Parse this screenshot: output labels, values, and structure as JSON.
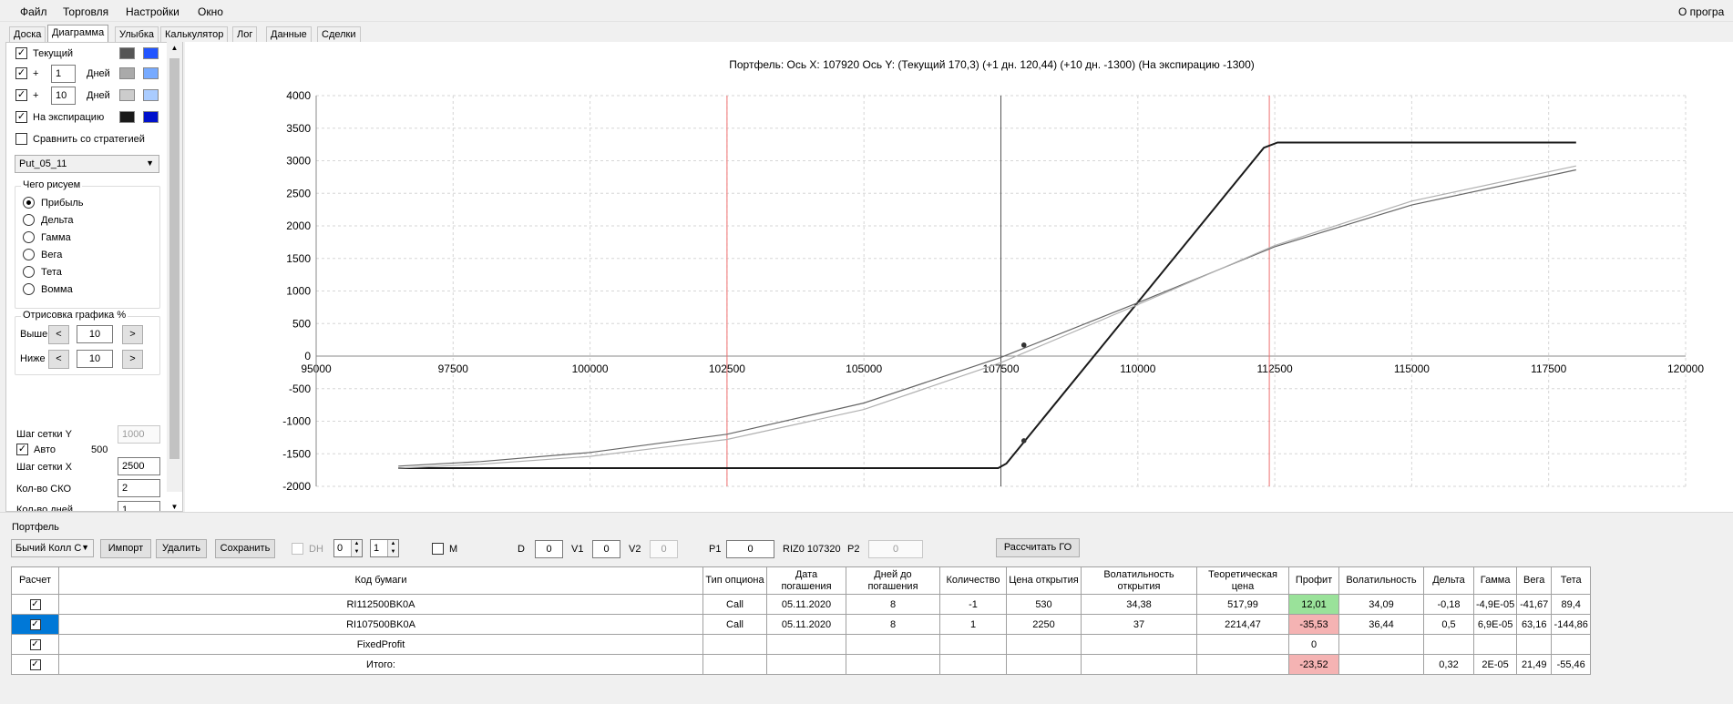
{
  "menu": {
    "file": "Файл",
    "trade": "Торговля",
    "settings": "Настройки",
    "window": "Окно",
    "about": "О програ"
  },
  "tabs": [
    "Доска",
    "Диаграмма",
    "Улыбка",
    "Калькулятор",
    "Лог",
    "Данные",
    "Сделки"
  ],
  "active_tab": "Диаграмма",
  "left": {
    "current_label": "Текущий",
    "plus": "+",
    "days_label": "Дней",
    "days1": "1",
    "days2": "10",
    "expiry_label": "На экспирацию",
    "compare_label": "Сравнить со стратегией",
    "strategy_select": "Put_05_11",
    "what_group": "Чего рисуем",
    "radios": [
      "Прибыль",
      "Дельта",
      "Гамма",
      "Вега",
      "Тета",
      "Вомма"
    ],
    "draw_group": "Отрисовка графика %",
    "above_label": "Выше",
    "below_label": "Ниже",
    "above_value": "10",
    "below_value": "10",
    "prev_glyph": "<",
    "next_glyph": ">",
    "grid_y_label": "Шаг сетки Y",
    "grid_y_value": "1000",
    "auto_label": "Авто",
    "auto_value": "500",
    "grid_x_label": "Шаг сетки X",
    "grid_x_value": "2500",
    "sko_label": "Кол-во СКО",
    "sko_value": "2",
    "days_count_label": "Кол-во дней",
    "days_count_value": "1"
  },
  "colors": {
    "current": [
      "#555555",
      "#2255ff"
    ],
    "plus1": [
      "#aaaaaa",
      "#77aaff"
    ],
    "plus10": [
      "#cccccc",
      "#aaccff"
    ],
    "expiry": [
      "#1a1a1a",
      "#0011cc"
    ]
  },
  "chart_data": {
    "type": "line",
    "title": "Портфель: Ось X: 107920 Ось Y:  (Текущий 170,3)  (+1 дн. 120,44)  (+10 дн. -1300)  (На экспирацию -1300)",
    "xlim": [
      95000,
      120000
    ],
    "ylim": [
      -2000,
      4000
    ],
    "x_ticks": [
      "95000",
      "97500",
      "100000",
      "102500",
      "105000",
      "107500",
      "110000",
      "112500",
      "115000",
      "117500",
      "120000"
    ],
    "y_ticks": [
      "4000",
      "3500",
      "3000",
      "2500",
      "2000",
      "1500",
      "1000",
      "500",
      "0",
      "-500",
      "-1000",
      "-1500",
      "-2000"
    ],
    "cursor_x": 107500,
    "red_lines": [
      102500,
      112400
    ],
    "markers": [
      {
        "x": 107920,
        "y": 170
      },
      {
        "x": 107920,
        "y": -1300
      }
    ],
    "series": [
      {
        "color": "#1a1a1a",
        "x": [
          96500,
          107450,
          107600,
          112300,
          112550,
          118000
        ],
        "y": [
          -1720,
          -1720,
          -1650,
          3200,
          3280,
          3280
        ]
      },
      {
        "color": "#666666",
        "x": [
          96500,
          98000,
          100000,
          102500,
          105000,
          107500,
          110000,
          112500,
          115000,
          118000
        ],
        "y": [
          -1690,
          -1620,
          -1480,
          -1200,
          -720,
          -20,
          820,
          1680,
          2320,
          2860
        ]
      },
      {
        "color": "#b0b0b0",
        "x": [
          96500,
          98000,
          100000,
          102500,
          105000,
          107500,
          110000,
          112500,
          115000,
          118000
        ],
        "y": [
          -1720,
          -1660,
          -1540,
          -1280,
          -820,
          -100,
          790,
          1700,
          2380,
          2920
        ]
      }
    ]
  },
  "portfolio": {
    "title": "Портфель",
    "select": "Бычий Колл С",
    "import": "Импорт",
    "delete": "Удалить",
    "save": "Сохранить",
    "dh": "DH",
    "spin1": "0",
    "spin2": "1",
    "m": "M",
    "d_label": "D",
    "d_value": "0",
    "v1_label": "V1",
    "v1_value": "0",
    "v2_label": "V2",
    "v2_value": "0",
    "p1_label": "P1",
    "p1_value": "0",
    "riz": "RIZ0 107320",
    "p2_label": "P2",
    "p2_value": "0",
    "calc_go": "Рассчитать ГО"
  },
  "table": {
    "headers": [
      "Расчет",
      "Код бумаги",
      "Тип опциона",
      "Дата погашения",
      "Дней до погашения",
      "Количество",
      "Цена открытия",
      "Волатильность открытия",
      "Теоретическая цена",
      "Профит",
      "Волатильность",
      "Дельта",
      "Гамма",
      "Вега",
      "Тета"
    ],
    "rows": [
      [
        "",
        "RI112500BK0A",
        "Call",
        "05.11.2020",
        "8",
        "-1",
        "530",
        "34,38",
        "517,99",
        "12,01",
        "34,09",
        "-0,18",
        "-4,9E-05",
        "-41,67",
        "89,4"
      ],
      [
        "",
        "RI107500BK0A",
        "Call",
        "05.11.2020",
        "8",
        "1",
        "2250",
        "37",
        "2214,47",
        "-35,53",
        "36,44",
        "0,5",
        "6,9E-05",
        "63,16",
        "-144,86"
      ],
      [
        "",
        "FixedProfit",
        "",
        "",
        "",
        "",
        "",
        "",
        "",
        "0",
        "",
        "",
        "",
        "",
        ""
      ],
      [
        "",
        "Итого:",
        "",
        "",
        "",
        "",
        "",
        "",
        "",
        "-23,52",
        "",
        "0,32",
        "2E-05",
        "21,49",
        "-55,46"
      ]
    ]
  }
}
